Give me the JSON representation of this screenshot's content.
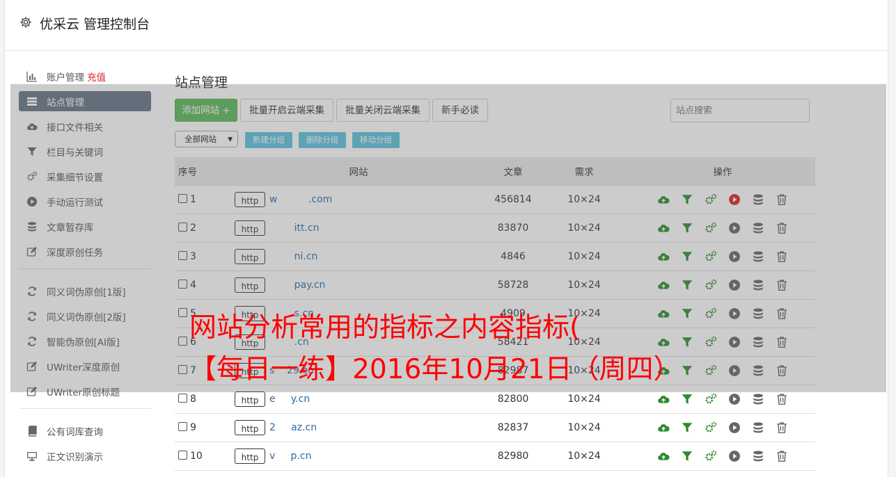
{
  "header": {
    "title": "优采云 管理控制台",
    "icon": "gear-icon"
  },
  "sidebar": {
    "items": [
      {
        "label": "账户管理",
        "extra": "充值",
        "icon": "bar-chart-icon"
      },
      {
        "label": "站点管理",
        "icon": "list-icon",
        "active": true
      },
      {
        "label": "接口文件相关",
        "icon": "cloud-upload-icon"
      },
      {
        "label": "栏目与关键词",
        "icon": "filter-icon"
      },
      {
        "label": "采集细节设置",
        "icon": "cogs-icon"
      },
      {
        "label": "手动运行测试",
        "icon": "play-icon"
      },
      {
        "label": "文章暂存库",
        "icon": "database-icon"
      },
      {
        "label": "深度原创任务",
        "icon": "edit-icon"
      }
    ],
    "items2": [
      {
        "label": "同义词伪原创[1版]",
        "icon": "refresh-icon"
      },
      {
        "label": "同义词伪原创[2版]",
        "icon": "refresh-icon"
      },
      {
        "label": "智能伪原创[AI版]",
        "icon": "refresh-icon"
      },
      {
        "label": "UWriter深度原创",
        "icon": "edit-icon"
      },
      {
        "label": "UWriter原创标题",
        "icon": "edit-icon"
      }
    ],
    "items3": [
      {
        "label": "公有词库查询",
        "icon": "book-icon"
      },
      {
        "label": "正文识别演示",
        "icon": "monitor-icon"
      }
    ]
  },
  "main": {
    "title": "站点管理",
    "toolbar": {
      "add": "添加网站 +",
      "batch_open": "批量开启云端采集",
      "batch_close": "批量关闭云端采集",
      "newbie": "新手必读",
      "search_placeholder": "站点搜索"
    },
    "group_select": "全部网站",
    "group_buttons": [
      "新建分组",
      "删除分组",
      "移动分组"
    ],
    "table": {
      "headers": [
        "序号",
        "网站",
        "文章",
        "需求",
        "操作"
      ],
      "rows": [
        {
          "id": "1",
          "proto": "http",
          "site": "w          .com",
          "articles": "456814",
          "demand": "10×24",
          "running": true
        },
        {
          "id": "2",
          "proto": "http",
          "site": "        itt.cn",
          "articles": "83870",
          "demand": "10×24"
        },
        {
          "id": "3",
          "proto": "http",
          "site": "        ni.cn",
          "articles": "4846",
          "demand": "10×24"
        },
        {
          "id": "4",
          "proto": "http",
          "site": "        pay.cn",
          "articles": "58728",
          "demand": "10×24"
        },
        {
          "id": "5",
          "proto": "http",
          "site": "        s.cn",
          "articles": "4909",
          "demand": "10×24"
        },
        {
          "id": "6",
          "proto": "http",
          "site": "        .cn",
          "articles": "58421",
          "demand": "10×24"
        },
        {
          "id": "7",
          "proto": "http",
          "site": "s    29.cn",
          "articles": "82987",
          "demand": "10×24"
        },
        {
          "id": "8",
          "proto": "http",
          "site": "e     y.cn",
          "articles": "82800",
          "demand": "10×24"
        },
        {
          "id": "9",
          "proto": "http",
          "site": "2     az.cn",
          "articles": "82837",
          "demand": "10×24"
        },
        {
          "id": "10",
          "proto": "http",
          "site": "v     p.cn",
          "articles": "82980",
          "demand": "10×24"
        }
      ]
    }
  },
  "watermark": {
    "line1": "网站分析常用的指标之内容指标(",
    "line2": "【每日一练】2016年10月21日（周四）"
  },
  "colors": {
    "green": "#5cb85c",
    "info": "#5bc0de",
    "active_nav": "#657385",
    "link": "#2a6aa8",
    "alert_red": "#e02020"
  }
}
